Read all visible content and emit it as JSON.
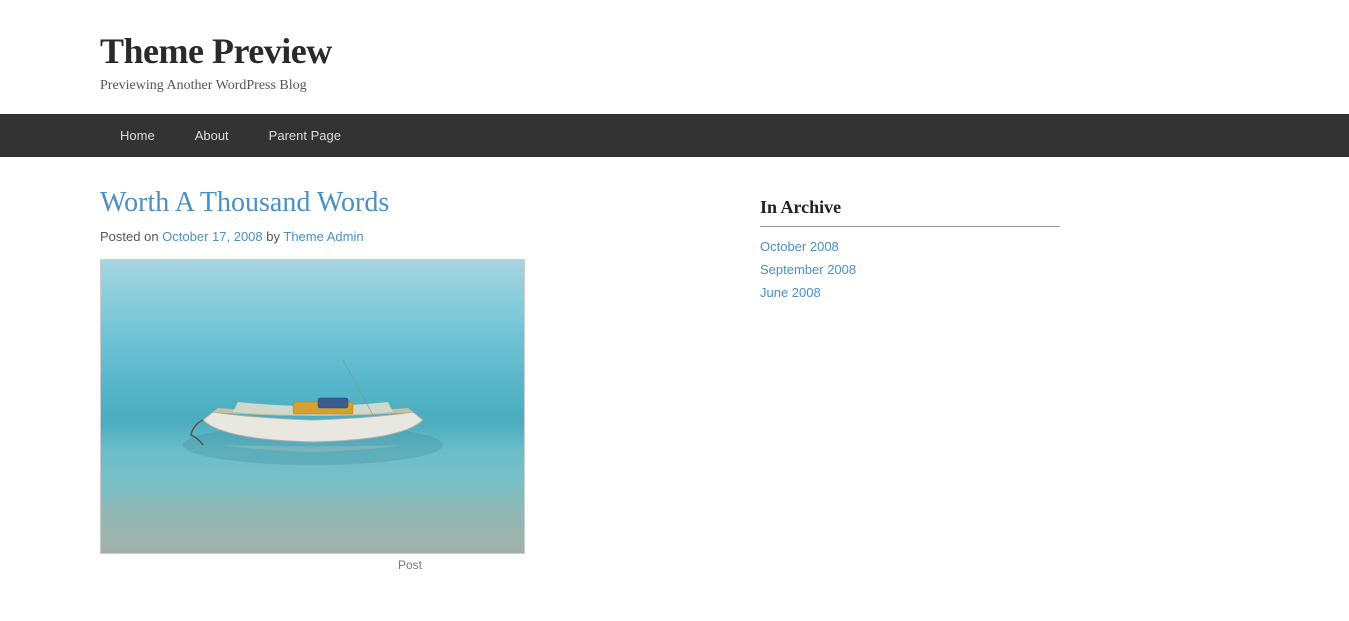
{
  "header": {
    "site_title": "Theme Preview",
    "site_tagline": "Previewing Another WordPress Blog"
  },
  "nav": {
    "items": [
      {
        "label": "Home",
        "href": "#"
      },
      {
        "label": "About",
        "href": "#"
      },
      {
        "label": "Parent Page",
        "href": "#"
      }
    ]
  },
  "post": {
    "title": "Worth A Thousand Words",
    "meta_posted_on": "Posted on",
    "meta_date": "October 17, 2008",
    "meta_by": "by",
    "meta_author": "Theme Admin",
    "image_caption": "Post"
  },
  "sidebar": {
    "archive_title": "In Archive",
    "archive_items": [
      {
        "label": "October 2008"
      },
      {
        "label": "September 2008"
      },
      {
        "label": "June 2008"
      }
    ]
  }
}
